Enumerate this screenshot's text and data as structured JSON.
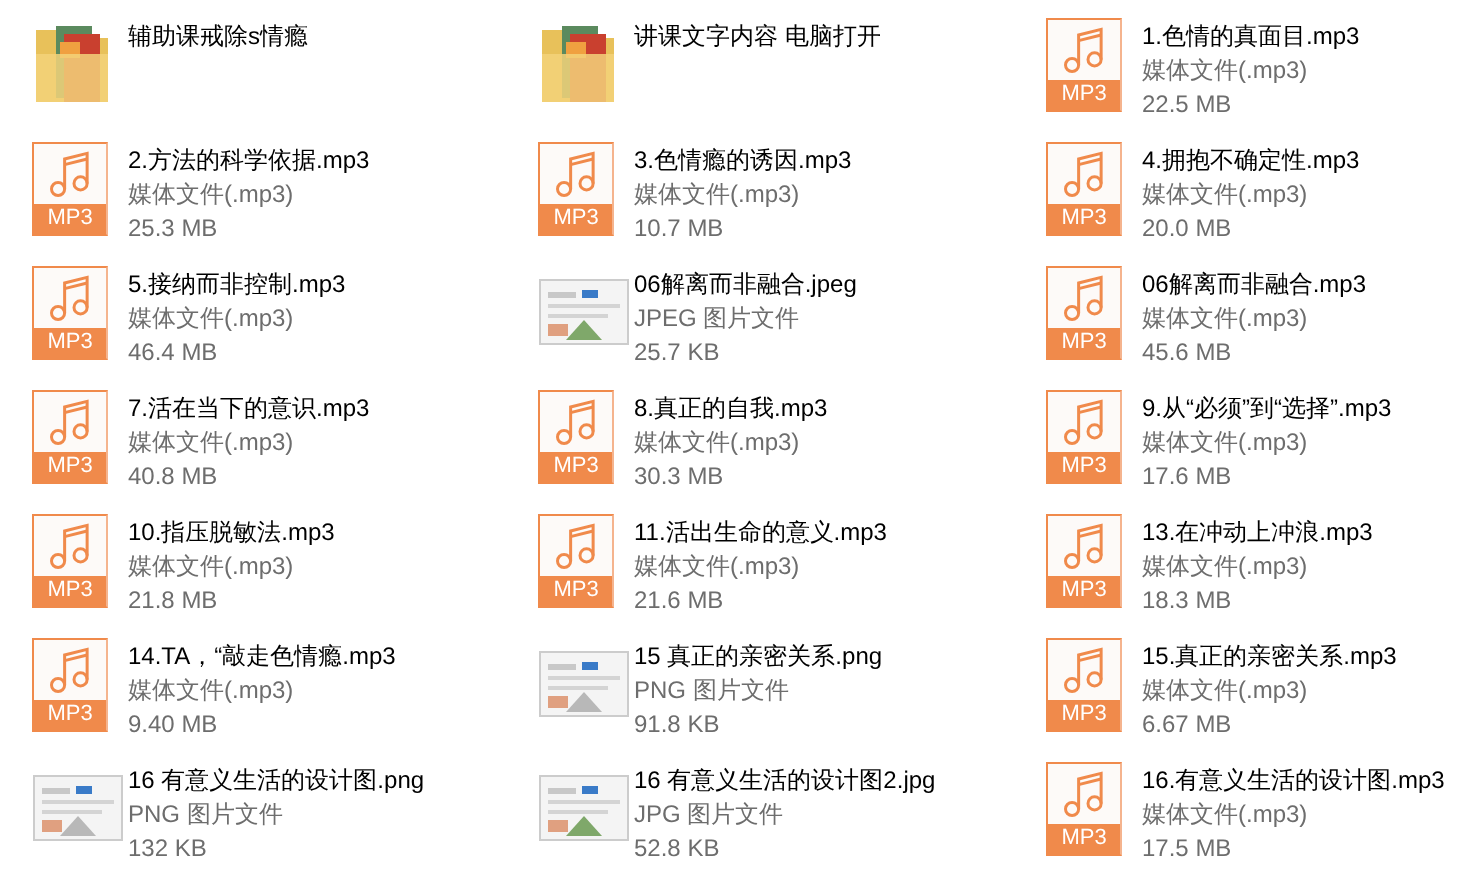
{
  "files": [
    {
      "kind": "folder",
      "name": "辅助课戒除s情瘾"
    },
    {
      "kind": "folder",
      "name": "讲课文字内容 电脑打开"
    },
    {
      "kind": "mp3",
      "name": "1.色情的真面目.mp3",
      "type": "媒体文件(.mp3)",
      "size": "22.5 MB",
      "badge": "MP3"
    },
    {
      "kind": "mp3",
      "name": "2.方法的科学依据.mp3",
      "type": "媒体文件(.mp3)",
      "size": "25.3 MB",
      "badge": "MP3"
    },
    {
      "kind": "mp3",
      "name": "3.色情瘾的诱因.mp3",
      "type": "媒体文件(.mp3)",
      "size": "10.7 MB",
      "badge": "MP3"
    },
    {
      "kind": "mp3",
      "name": "4.拥抱不确定性.mp3",
      "type": "媒体文件(.mp3)",
      "size": "20.0 MB",
      "badge": "MP3"
    },
    {
      "kind": "mp3",
      "name": "5.接纳而非控制.mp3",
      "type": "媒体文件(.mp3)",
      "size": "46.4 MB",
      "badge": "MP3"
    },
    {
      "name": "06解离而非融合.jpeg",
      "type": "JPEG 图片文件",
      "size": "25.7 KB"
    },
    {
      "kind": "mp3",
      "name": "06解离而非融合.mp3",
      "type": "媒体文件(.mp3)",
      "size": "45.6 MB",
      "badge": "MP3"
    },
    {
      "kind": "mp3",
      "name": "7.活在当下的意识.mp3",
      "type": "媒体文件(.mp3)",
      "size": "40.8 MB",
      "badge": "MP3"
    },
    {
      "kind": "mp3",
      "name": "8.真正的自我.mp3",
      "type": "媒体文件(.mp3)",
      "size": "30.3 MB",
      "badge": "MP3"
    },
    {
      "kind": "mp3",
      "name": "9.从“必须”到“选择”.mp3",
      "type": "媒体文件(.mp3)",
      "size": "17.6 MB",
      "badge": "MP3"
    },
    {
      "kind": "mp3",
      "name": "10.指压脱敏法.mp3",
      "type": "媒体文件(.mp3)",
      "size": "21.8 MB",
      "badge": "MP3"
    },
    {
      "kind": "mp3",
      "name": "11.活出生命的意义.mp3",
      "type": "媒体文件(.mp3)",
      "size": "21.6 MB",
      "badge": "MP3"
    },
    {
      "kind": "mp3",
      "name": "13.在冲动上冲浪.mp3",
      "type": "媒体文件(.mp3)",
      "size": "18.3 MB",
      "badge": "MP3"
    },
    {
      "kind": "mp3",
      "name": "14.TA，“敲走色情瘾.mp3",
      "type": "媒体文件(.mp3)",
      "size": "9.40 MB",
      "badge": "MP3"
    },
    {
      "name": "15 真正的亲密关系.png",
      "type": "PNG 图片文件",
      "size": "91.8 KB"
    },
    {
      "kind": "mp3",
      "name": "15.真正的亲密关系.mp3",
      "type": "媒体文件(.mp3)",
      "size": "6.67 MB",
      "badge": "MP3"
    },
    {
      "name": "16 有意义生活的设计图.png",
      "type": "PNG 图片文件",
      "size": "132 KB"
    },
    {
      "name": "16 有意义生活的设计图2.jpg",
      "type": "JPG 图片文件",
      "size": "52.8 KB"
    },
    {
      "kind": "mp3",
      "name": "16.有意义生活的设计图.mp3",
      "type": "媒体文件(.mp3)",
      "size": "17.5 MB",
      "badge": "MP3"
    }
  ]
}
